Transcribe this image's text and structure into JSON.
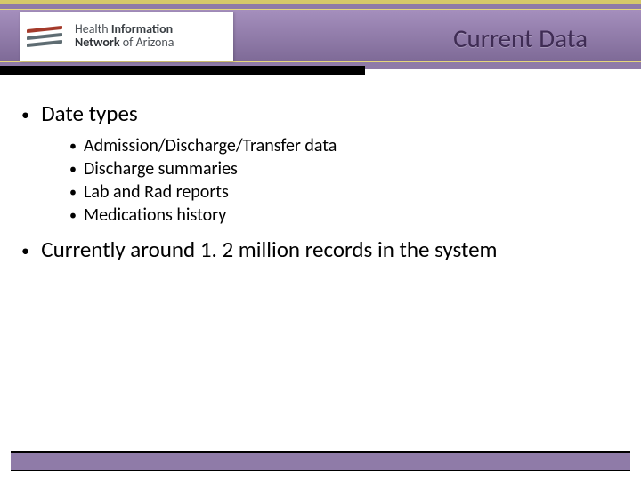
{
  "header": {
    "title": "Current Data",
    "logo": {
      "line1_prefix": "Health ",
      "line1_emph": "Information",
      "line2_emph": "Network",
      "line2_suffix": " of Arizona"
    }
  },
  "body": {
    "bullets": [
      {
        "text": "Date types",
        "sub": [
          "Admission/Discharge/Transfer data",
          "Discharge summaries",
          "Lab and Rad reports",
          "Medications history"
        ]
      },
      {
        "text": "Currently around 1. 2 million records in the system",
        "sub": []
      }
    ]
  }
}
